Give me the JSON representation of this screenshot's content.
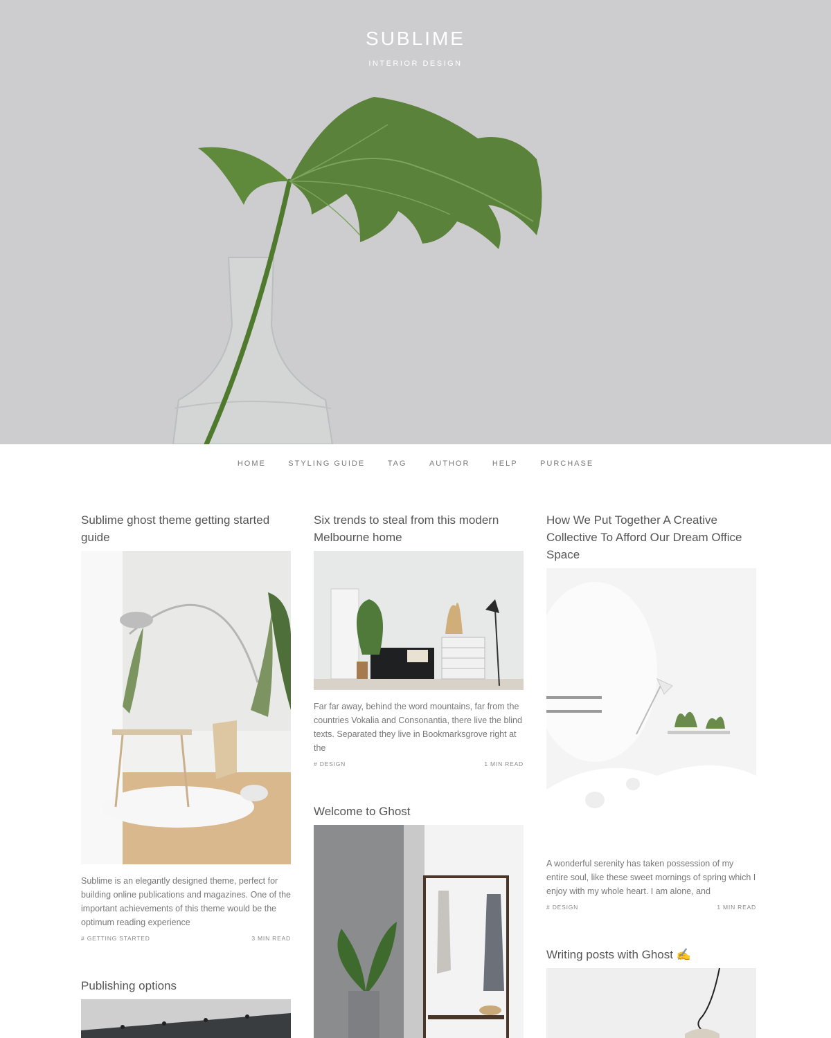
{
  "site": {
    "title": "SUBLIME",
    "tagline": "INTERIOR DESIGN"
  },
  "nav": {
    "items": [
      {
        "label": "HOME"
      },
      {
        "label": "STYLING GUIDE"
      },
      {
        "label": "TAG"
      },
      {
        "label": "AUTHOR"
      },
      {
        "label": "HELP"
      },
      {
        "label": "PURCHASE"
      }
    ]
  },
  "posts": {
    "p1": {
      "title": "Sublime ghost theme getting started guide",
      "excerpt": "Sublime is an elegantly designed theme, perfect for building online publications and magazines. One of the important achievements of this theme would be the optimum reading experience",
      "tag": "# GETTING STARTED",
      "read": "3 MIN READ"
    },
    "p2": {
      "title": "Six trends to steal from this modern Melbourne home",
      "excerpt": "Far far away, behind the word mountains, far from the countries Vokalia and Consonantia, there live the blind texts. Separated they live in Bookmarksgrove right at the",
      "tag": "# DESIGN",
      "read": "1 MIN READ"
    },
    "p3": {
      "title": "How We Put Together A Creative Collective To Afford Our Dream Office Space",
      "excerpt": "A wonderful serenity has taken possession of my entire soul, like these sweet mornings of spring which I enjoy with my whole heart. I am alone, and",
      "tag": "# DESIGN",
      "read": "1 MIN READ"
    },
    "p4": {
      "title": "Publishing options"
    },
    "p5": {
      "title": "Welcome to Ghost"
    },
    "p6": {
      "title": "Writing posts with Ghost ✍️"
    }
  },
  "colors": {
    "hero_bg": "#cdcdcf",
    "leaf": "#5b7f3a",
    "text": "#555555"
  }
}
